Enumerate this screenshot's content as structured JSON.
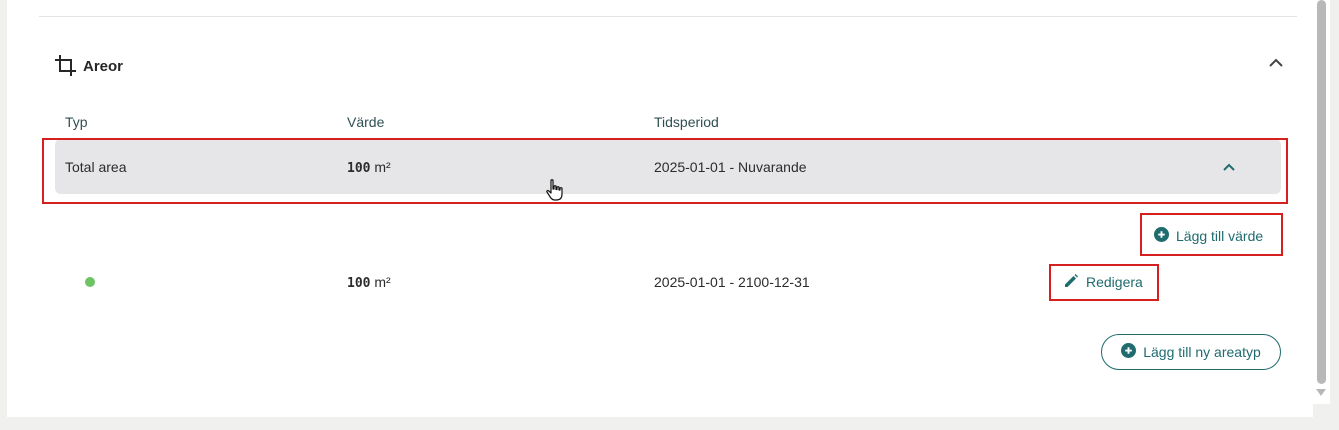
{
  "section": {
    "title": "Areor",
    "icon": "crop-icon"
  },
  "table": {
    "headers": {
      "type": "Typ",
      "value": "Värde",
      "period": "Tidsperiod"
    },
    "total_row": {
      "type": "Total area",
      "value_number": "100",
      "value_unit": "m²",
      "period": "2025-01-01 - Nuvarande"
    },
    "detail_row": {
      "status_color": "#6cc465",
      "value_number": "100",
      "value_unit": "m²",
      "period": "2025-01-01 - 2100-12-31",
      "edit_label": "Redigera"
    }
  },
  "actions": {
    "add_value_label": "Lägg till värde",
    "add_area_type_label": "Lägg till ny areatyp"
  },
  "colors": {
    "accent": "#1f6b6e",
    "row_bg": "#e6e6e8",
    "highlight_box": "#d62020"
  }
}
